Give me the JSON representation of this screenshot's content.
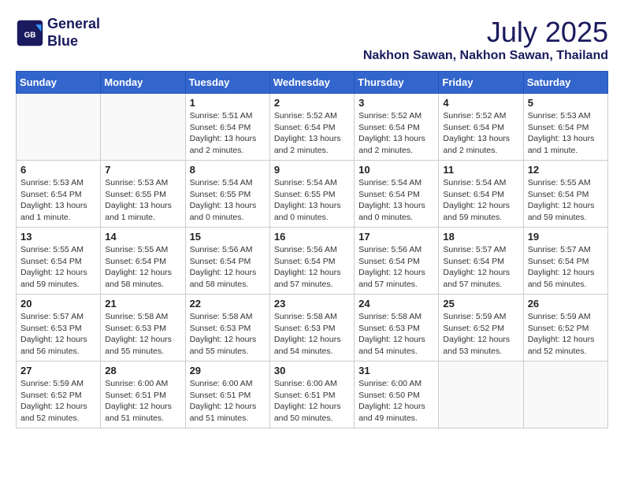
{
  "header": {
    "logo_line1": "General",
    "logo_line2": "Blue",
    "month": "July 2025",
    "location": "Nakhon Sawan, Nakhon Sawan, Thailand"
  },
  "days_of_week": [
    "Sunday",
    "Monday",
    "Tuesday",
    "Wednesday",
    "Thursday",
    "Friday",
    "Saturday"
  ],
  "weeks": [
    [
      {
        "day": "",
        "info": ""
      },
      {
        "day": "",
        "info": ""
      },
      {
        "day": "1",
        "info": "Sunrise: 5:51 AM\nSunset: 6:54 PM\nDaylight: 13 hours and 2 minutes."
      },
      {
        "day": "2",
        "info": "Sunrise: 5:52 AM\nSunset: 6:54 PM\nDaylight: 13 hours and 2 minutes."
      },
      {
        "day": "3",
        "info": "Sunrise: 5:52 AM\nSunset: 6:54 PM\nDaylight: 13 hours and 2 minutes."
      },
      {
        "day": "4",
        "info": "Sunrise: 5:52 AM\nSunset: 6:54 PM\nDaylight: 13 hours and 2 minutes."
      },
      {
        "day": "5",
        "info": "Sunrise: 5:53 AM\nSunset: 6:54 PM\nDaylight: 13 hours and 1 minute."
      }
    ],
    [
      {
        "day": "6",
        "info": "Sunrise: 5:53 AM\nSunset: 6:54 PM\nDaylight: 13 hours and 1 minute."
      },
      {
        "day": "7",
        "info": "Sunrise: 5:53 AM\nSunset: 6:55 PM\nDaylight: 13 hours and 1 minute."
      },
      {
        "day": "8",
        "info": "Sunrise: 5:54 AM\nSunset: 6:55 PM\nDaylight: 13 hours and 0 minutes."
      },
      {
        "day": "9",
        "info": "Sunrise: 5:54 AM\nSunset: 6:55 PM\nDaylight: 13 hours and 0 minutes."
      },
      {
        "day": "10",
        "info": "Sunrise: 5:54 AM\nSunset: 6:54 PM\nDaylight: 13 hours and 0 minutes."
      },
      {
        "day": "11",
        "info": "Sunrise: 5:54 AM\nSunset: 6:54 PM\nDaylight: 12 hours and 59 minutes."
      },
      {
        "day": "12",
        "info": "Sunrise: 5:55 AM\nSunset: 6:54 PM\nDaylight: 12 hours and 59 minutes."
      }
    ],
    [
      {
        "day": "13",
        "info": "Sunrise: 5:55 AM\nSunset: 6:54 PM\nDaylight: 12 hours and 59 minutes."
      },
      {
        "day": "14",
        "info": "Sunrise: 5:55 AM\nSunset: 6:54 PM\nDaylight: 12 hours and 58 minutes."
      },
      {
        "day": "15",
        "info": "Sunrise: 5:56 AM\nSunset: 6:54 PM\nDaylight: 12 hours and 58 minutes."
      },
      {
        "day": "16",
        "info": "Sunrise: 5:56 AM\nSunset: 6:54 PM\nDaylight: 12 hours and 57 minutes."
      },
      {
        "day": "17",
        "info": "Sunrise: 5:56 AM\nSunset: 6:54 PM\nDaylight: 12 hours and 57 minutes."
      },
      {
        "day": "18",
        "info": "Sunrise: 5:57 AM\nSunset: 6:54 PM\nDaylight: 12 hours and 57 minutes."
      },
      {
        "day": "19",
        "info": "Sunrise: 5:57 AM\nSunset: 6:54 PM\nDaylight: 12 hours and 56 minutes."
      }
    ],
    [
      {
        "day": "20",
        "info": "Sunrise: 5:57 AM\nSunset: 6:53 PM\nDaylight: 12 hours and 56 minutes."
      },
      {
        "day": "21",
        "info": "Sunrise: 5:58 AM\nSunset: 6:53 PM\nDaylight: 12 hours and 55 minutes."
      },
      {
        "day": "22",
        "info": "Sunrise: 5:58 AM\nSunset: 6:53 PM\nDaylight: 12 hours and 55 minutes."
      },
      {
        "day": "23",
        "info": "Sunrise: 5:58 AM\nSunset: 6:53 PM\nDaylight: 12 hours and 54 minutes."
      },
      {
        "day": "24",
        "info": "Sunrise: 5:58 AM\nSunset: 6:53 PM\nDaylight: 12 hours and 54 minutes."
      },
      {
        "day": "25",
        "info": "Sunrise: 5:59 AM\nSunset: 6:52 PM\nDaylight: 12 hours and 53 minutes."
      },
      {
        "day": "26",
        "info": "Sunrise: 5:59 AM\nSunset: 6:52 PM\nDaylight: 12 hours and 52 minutes."
      }
    ],
    [
      {
        "day": "27",
        "info": "Sunrise: 5:59 AM\nSunset: 6:52 PM\nDaylight: 12 hours and 52 minutes."
      },
      {
        "day": "28",
        "info": "Sunrise: 6:00 AM\nSunset: 6:51 PM\nDaylight: 12 hours and 51 minutes."
      },
      {
        "day": "29",
        "info": "Sunrise: 6:00 AM\nSunset: 6:51 PM\nDaylight: 12 hours and 51 minutes."
      },
      {
        "day": "30",
        "info": "Sunrise: 6:00 AM\nSunset: 6:51 PM\nDaylight: 12 hours and 50 minutes."
      },
      {
        "day": "31",
        "info": "Sunrise: 6:00 AM\nSunset: 6:50 PM\nDaylight: 12 hours and 49 minutes."
      },
      {
        "day": "",
        "info": ""
      },
      {
        "day": "",
        "info": ""
      }
    ]
  ]
}
